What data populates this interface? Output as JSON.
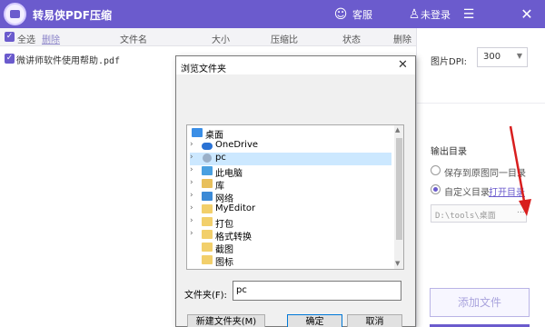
{
  "app": {
    "title": "转易侠PDF压缩",
    "support_label": "客服",
    "login_label": "未登录",
    "accent_color": "#6b5bcd"
  },
  "list": {
    "select_all": "全选",
    "delete": "删除",
    "columns": [
      "文件名",
      "大小",
      "压缩比",
      "状态",
      "删除"
    ],
    "files": [
      {
        "name": "微讲师软件使用帮助.pdf"
      }
    ]
  },
  "settings": {
    "dpi_label": "图片DPI:",
    "dpi_value": "300",
    "output_title": "输出目录",
    "option_same": "保存到原图同一目录",
    "option_custom": "自定义目录",
    "open_dir": "打开目录",
    "path_value": "D:\\tools\\桌面",
    "path_button": "...",
    "add_file": "添加文件"
  },
  "dialog": {
    "title": "浏览文件夹",
    "close": "✕",
    "tree": [
      {
        "label": "桌面",
        "icon": "desktop-icon",
        "chevron": ""
      },
      {
        "label": "OneDrive",
        "icon": "cloud-icon",
        "chevron": "›"
      },
      {
        "label": "pc",
        "icon": "user-icon",
        "chevron": "›"
      },
      {
        "label": "此电脑",
        "icon": "computer-icon",
        "chevron": "›"
      },
      {
        "label": "库",
        "icon": "library-icon",
        "chevron": "›"
      },
      {
        "label": "网络",
        "icon": "network-icon",
        "chevron": "›"
      },
      {
        "label": "MyEditor",
        "icon": "folder-icon",
        "chevron": "›"
      },
      {
        "label": "打包",
        "icon": "folder-icon",
        "chevron": "›"
      },
      {
        "label": "格式转换",
        "icon": "folder-icon",
        "chevron": "›"
      },
      {
        "label": "截图",
        "icon": "folder-icon",
        "chevron": ""
      },
      {
        "label": "图标",
        "icon": "folder-icon",
        "chevron": ""
      }
    ],
    "folder_label": "文件夹(F):",
    "folder_value": "pc",
    "new_folder": "新建文件夹(M)",
    "ok": "确定",
    "cancel": "取消"
  }
}
